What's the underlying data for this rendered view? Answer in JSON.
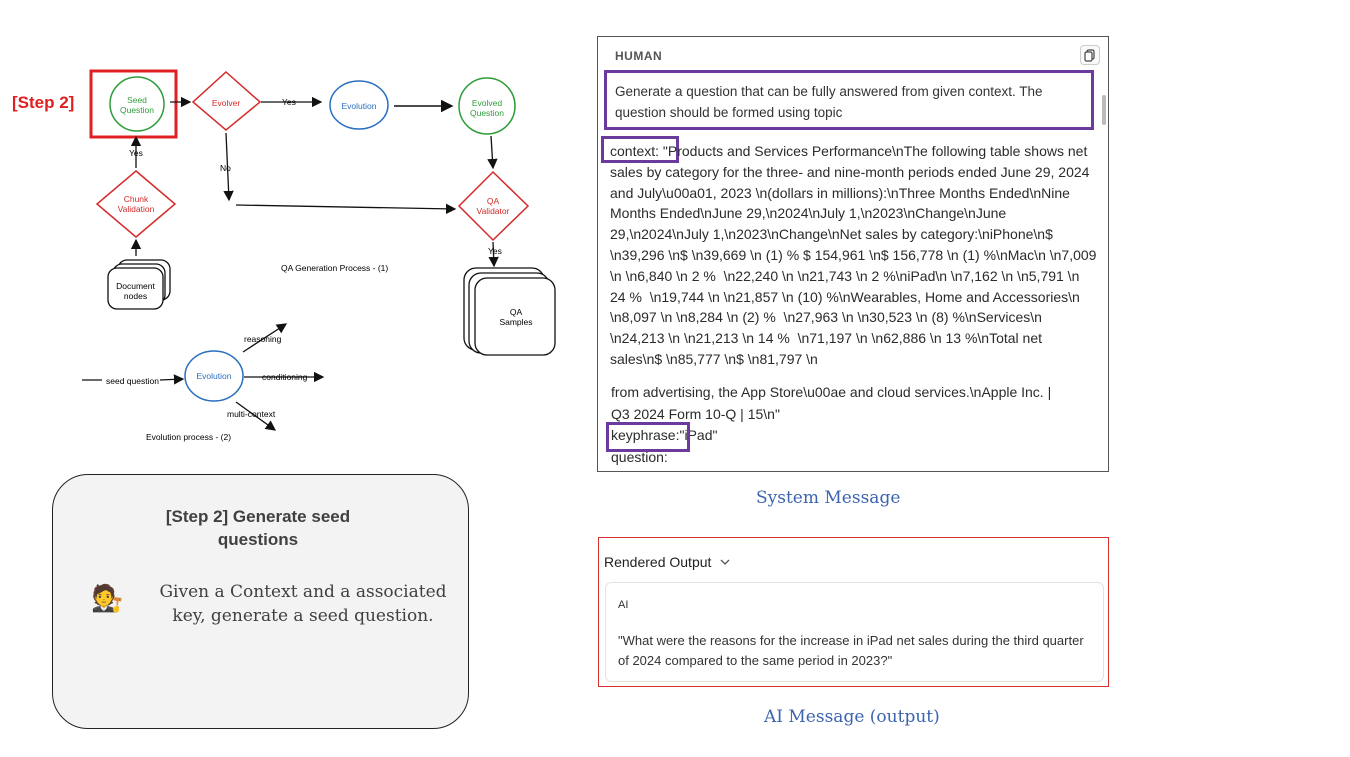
{
  "diagram": {
    "step_marker": "[Step 2]",
    "nodes": {
      "seed_question": "Seed\nQuestion",
      "evolver": "Evolver",
      "evolution": "Evolution",
      "evolved_question": "Evolved\nQuestion",
      "chunk_validation": "Chunk\nValidation",
      "qa_validator": "QA\nValidator",
      "document_nodes": "Document\nnodes",
      "qa_samples": "QA\nSamples",
      "evolution_center": "Evolution"
    },
    "edges": {
      "yes_top": "Yes",
      "no": "No",
      "yes_left": "Yes",
      "yes_right": "Yes",
      "seed_question_in": "seed question",
      "reasoning": "reasoning",
      "conditioning": "conditioning",
      "multi_context": "multi-context"
    },
    "captions": {
      "qa_process": "QA Generation Process - (1)",
      "evolution_process": "Evolution process - (2)"
    },
    "colors": {
      "green": "#2e9d3a",
      "red": "#d42a2a",
      "blue": "#2a6fc0",
      "highlight": "#e02020"
    }
  },
  "card": {
    "title": "[Step 2] Generate seed questions",
    "body": "Given a Context and a associated key, generate a seed question.",
    "emoji": "🧑‍⚖️"
  },
  "human_panel": {
    "label": "HUMAN",
    "prompt": "Generate a question that can be fully answered from given context. The question should be formed using topic",
    "context_label": "context:",
    "context_value": " \"Products and Services Performance\\nThe following table shows net sales by category for the three- and nine-month periods ended June 29, 2024 and July\\u00a01, 2023 \\n(dollars in millions):\\nThree Months Ended\\nNine Months Ended\\nJune 29,\\n2024\\nJuly 1,\\n2023\\nChange\\nJune 29,\\n2024\\nJuly 1,\\n2023\\nChange\\nNet sales by category:\\niPhone\\n$ \\n39,296 \\n$ \\n39,669 \\n (1) % $ 154,961 \\n$ 156,778 \\n (1) %\\nMac\\n \\n7,009 \\n \\n6,840 \\n 2 %  \\n22,240 \\n \\n21,743 \\n 2 %\\niPad\\n \\n7,162 \\n \\n5,791 \\n 24 %  \\n19,744 \\n \\n21,857 \\n (10) %\\nWearables, Home and Accessories\\n \\n8,097 \\n \\n8,284 \\n (2) %  \\n27,963 \\n \\n30,523 \\n (8) %\\nServices\\n \\n24,213 \\n \\n21,213 \\n 14 %  \\n71,197 \\n \\n62,886 \\n 13 %\\nTotal net sales\\n$ \\n85,777 \\n$ \\n81,797 \\n",
    "tail_line1": "from advertising, the App Store\\u00ae and cloud services.\\nApple Inc. |",
    "tail_line2": "Q3 2024 Form 10-Q | 15\\n\"",
    "keyphrase_label": "keyphrase:",
    "keyphrase_value": "\"iPad\"",
    "question_label": "question:",
    "caption": "System Message"
  },
  "output_panel": {
    "title": "Rendered Output",
    "ai_label": "AI",
    "ai_text": "\"What were the reasons for the increase in iPad net sales during the third quarter of 2024 compared to the same period in 2023?\"",
    "caption": "AI Message (output)"
  }
}
